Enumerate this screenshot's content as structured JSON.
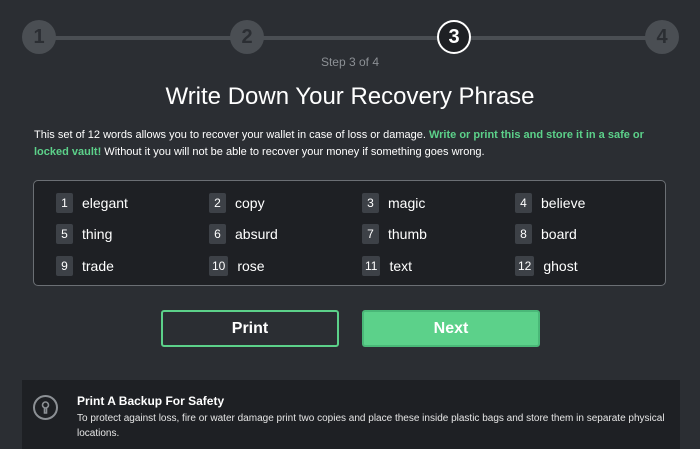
{
  "stepper": {
    "steps": [
      "1",
      "2",
      "3",
      "4"
    ],
    "active_step": 3,
    "caption": "Step 3 of 4"
  },
  "title": "Write Down Your Recovery Phrase",
  "description": {
    "text_before": "This set of 12 words allows you to recover your wallet in case of loss or damage. ",
    "highlight": "Write or print this and store it in a safe or locked vault!",
    "text_after": " Without it you will not be able to recover your money if something goes wrong."
  },
  "words": [
    {
      "num": "1",
      "word": "elegant"
    },
    {
      "num": "2",
      "word": "copy"
    },
    {
      "num": "3",
      "word": "magic"
    },
    {
      "num": "4",
      "word": "believe"
    },
    {
      "num": "5",
      "word": "thing"
    },
    {
      "num": "6",
      "word": "absurd"
    },
    {
      "num": "7",
      "word": "thumb"
    },
    {
      "num": "8",
      "word": "board"
    },
    {
      "num": "9",
      "word": "trade"
    },
    {
      "num": "10",
      "word": "rose"
    },
    {
      "num": "11",
      "word": "text"
    },
    {
      "num": "12",
      "word": "ghost"
    }
  ],
  "buttons": {
    "print_label": "Print",
    "next_label": "Next"
  },
  "backup": {
    "icon": "keyhole-icon",
    "title": "Print A Backup For Safety",
    "text": "To protect against loss, fire or water damage print two copies and place these inside plastic bags and store them in separate physical locations."
  },
  "colors": {
    "background": "#2b2e33",
    "panel": "#1e2024",
    "accent_green": "#5cd18a",
    "step_inactive": "#4a4e53"
  }
}
